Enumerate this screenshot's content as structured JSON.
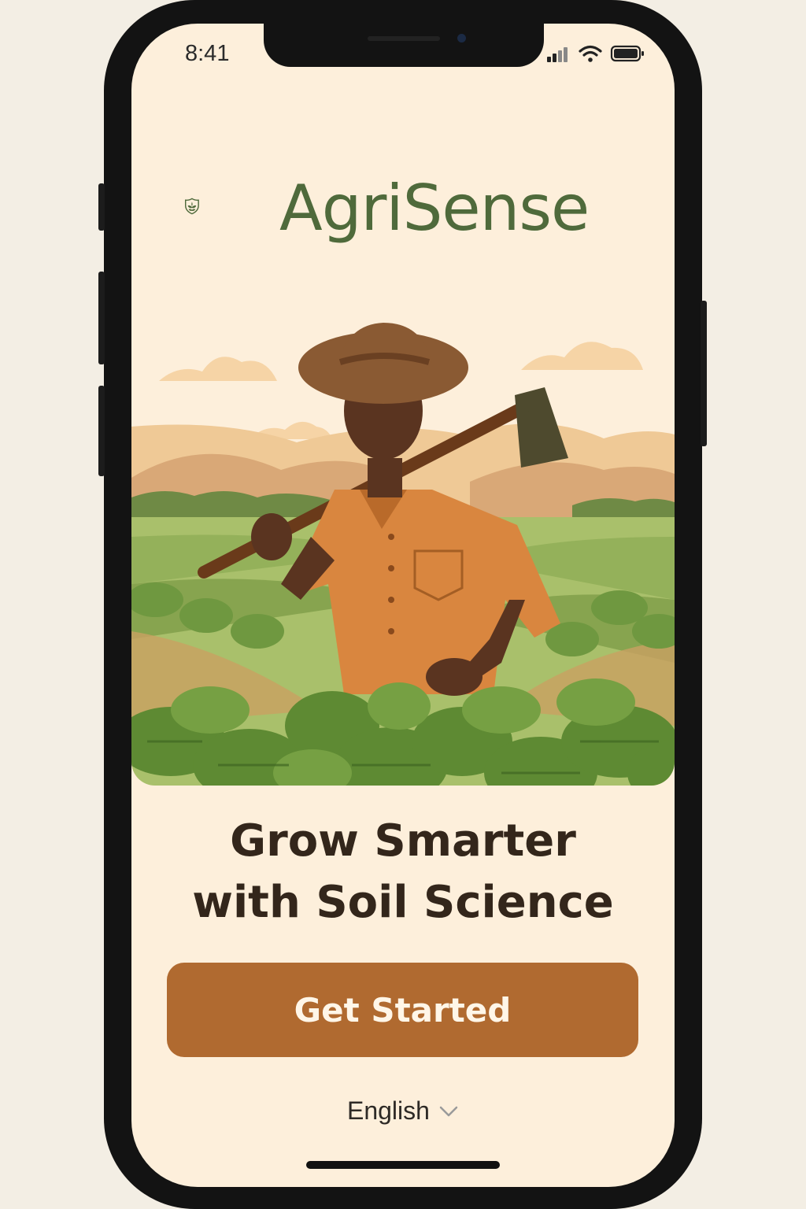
{
  "status_bar": {
    "time": "8:41",
    "icons": [
      "cellular-signal-icon",
      "wifi-icon",
      "battery-icon"
    ]
  },
  "brand": {
    "name": "AgriSense",
    "logo_icon": "shield-leaf-icon",
    "color": "#4f6a3b"
  },
  "hero": {
    "illustration": "farmer-in-field-illustration"
  },
  "headline": {
    "line1": "Grow Smarter",
    "line2": "with Soil Science"
  },
  "cta": {
    "label": "Get Started",
    "color": "#b06a30"
  },
  "language": {
    "selected": "English",
    "icon": "chevron-down-icon"
  },
  "colors": {
    "background": "#fdefdb",
    "headline": "#33261b"
  }
}
